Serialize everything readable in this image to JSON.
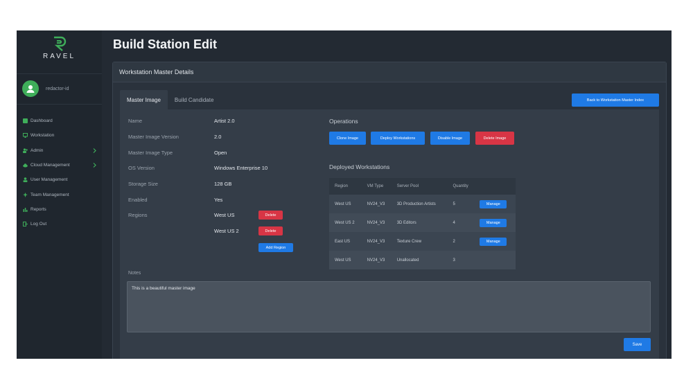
{
  "brand": {
    "name": "RAVEL",
    "color": "#3fae5a"
  },
  "user": {
    "name": "redactor-id"
  },
  "sidebar": {
    "items": [
      {
        "label": "Dashboard",
        "icon": "dashboard-icon",
        "has_submenu": false
      },
      {
        "label": "Workstation",
        "icon": "monitor-icon",
        "has_submenu": false
      },
      {
        "label": "Admin",
        "icon": "users-icon",
        "has_submenu": true
      },
      {
        "label": "Cloud Management",
        "icon": "cloud-icon",
        "has_submenu": true
      },
      {
        "label": "User Management",
        "icon": "user-icon",
        "has_submenu": false
      },
      {
        "label": "Team Management",
        "icon": "team-icon",
        "has_submenu": false
      },
      {
        "label": "Reports",
        "icon": "chart-icon",
        "has_submenu": false
      },
      {
        "label": "Log Out",
        "icon": "logout-icon",
        "has_submenu": false
      }
    ]
  },
  "page": {
    "title": "Build Station Edit"
  },
  "card": {
    "title": "Workstation Master Details"
  },
  "tabs": [
    {
      "label": "Master Image",
      "active": true
    },
    {
      "label": "Build Candidate",
      "active": false
    }
  ],
  "back_button": "Back to Workstation Master Index",
  "details": {
    "name_label": "Name",
    "name_value": "Artist 2.0",
    "version_label": "Master Image Version",
    "version_value": "2.0",
    "type_label": "Master Image Type",
    "type_value": "Open",
    "os_label": "OS Version",
    "os_value": "Windows Enterprise 10",
    "storage_label": "Storage Size",
    "storage_value": "128 GB",
    "enabled_label": "Enabled",
    "enabled_value": "Yes",
    "regions_label": "Regions",
    "regions": [
      "West US",
      "West US 2"
    ],
    "delete_label": "Delete",
    "add_region": "Add Region"
  },
  "operations": {
    "title": "Operations",
    "clone": "Clone Image",
    "deploy": "Deploy Workstations",
    "disable": "Disable Image",
    "delete": "Delete Image"
  },
  "deployed": {
    "title": "Deployed Workstations",
    "columns": [
      "Region",
      "VM Type",
      "Server Pool",
      "Quantity"
    ],
    "rows": [
      {
        "region": "West US",
        "vm": "NV24_V3",
        "pool": "3D Production Artists",
        "qty": "5",
        "manage": true
      },
      {
        "region": "West US 2",
        "vm": "NV24_V3",
        "pool": "3D Editors",
        "qty": "4",
        "manage": true
      },
      {
        "region": "East US",
        "vm": "NV24_V3",
        "pool": "Texture Crew",
        "qty": "2",
        "manage": true
      },
      {
        "region": "West US",
        "vm": "NV24_V3",
        "pool": "Unallocated",
        "qty": "3",
        "manage": false
      }
    ],
    "manage_label": "Manage"
  },
  "notes": {
    "label": "Notes",
    "value": "This is a beautiful master image"
  },
  "save_label": "Save",
  "colors": {
    "accent": "#1f7ae5",
    "danger": "#d83545",
    "sidebar_bg": "#1f262e",
    "main_bg": "#232a33"
  }
}
